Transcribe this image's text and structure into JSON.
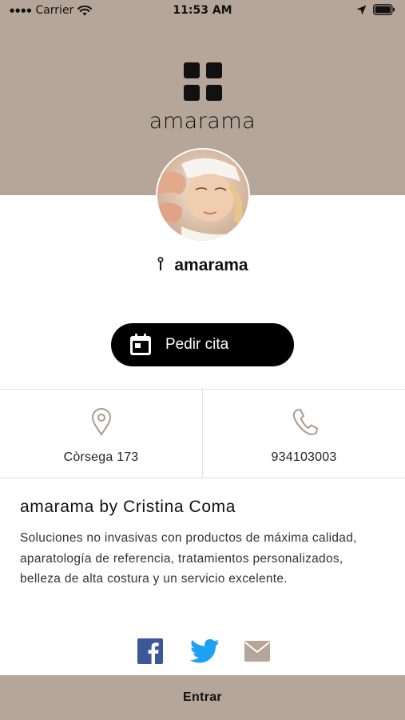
{
  "status_bar": {
    "carrier": "Carrier",
    "time": "11:53 AM",
    "icons": [
      "signal-dots-icon",
      "wifi-icon",
      "location-arrow-icon",
      "battery-icon"
    ]
  },
  "brand": {
    "logo_text": "amarama",
    "header_color": "#b5a699"
  },
  "place": {
    "name": "amarama",
    "icon": "pin-icon"
  },
  "cta": {
    "label": "Pedir cita",
    "icon": "calendar-icon",
    "color": "#000000"
  },
  "info": {
    "address": "Còrsega 173",
    "address_icon": "location-pin-icon",
    "phone": "934103003",
    "phone_icon": "phone-icon"
  },
  "description": {
    "title": "amarama by Cristina Coma",
    "body": "Soluciones no invasivas con productos de máxima calidad, aparatología de referencia, tratamientos personalizados, belleza de alta costura y un servicio excelente."
  },
  "social": {
    "items": [
      "facebook-icon",
      "twitter-icon",
      "email-icon"
    ],
    "facebook_color": "#3b5998",
    "twitter_color": "#1da1f2",
    "email_color": "#b5a699"
  },
  "footer": {
    "label": "Entrar"
  }
}
